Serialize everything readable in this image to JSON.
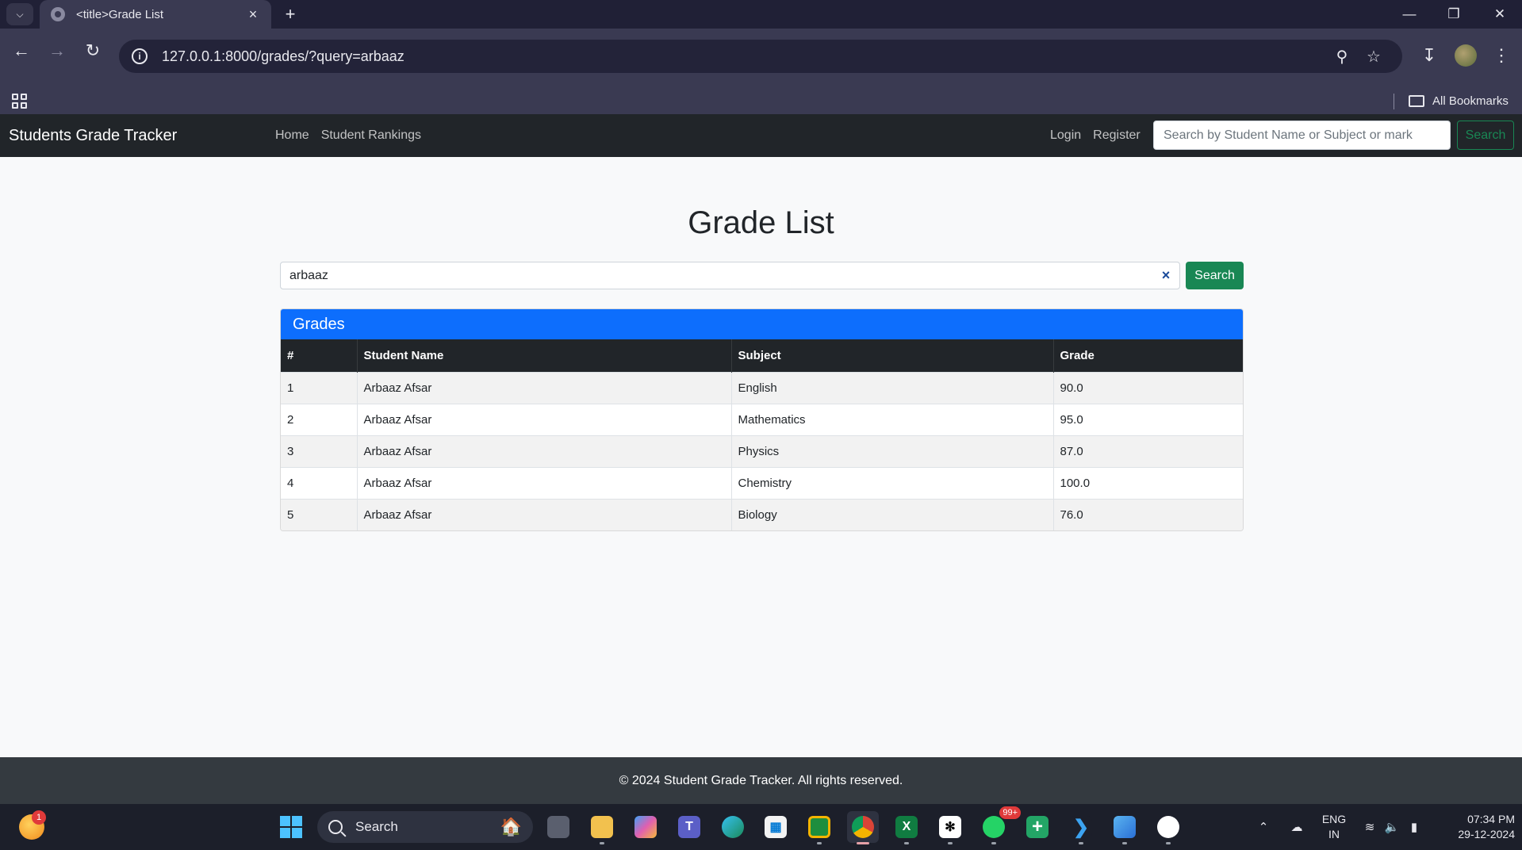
{
  "browser": {
    "tab_title": "<title>Grade List",
    "url": "127.0.0.1:8000/grades/?query=arbaaz",
    "bookmarks_label": "All Bookmarks"
  },
  "navbar": {
    "brand": "Students Grade Tracker",
    "links": [
      "Home",
      "Student Rankings"
    ],
    "login": "Login",
    "register": "Register",
    "search_placeholder": "Search by Student Name or Subject or mark",
    "search_button": "Search"
  },
  "main": {
    "title": "Grade List",
    "search_value": "arbaaz",
    "clear_symbol": "×",
    "search_button": "Search",
    "card_title": "Grades",
    "columns": [
      "#",
      "Student Name",
      "Subject",
      "Grade"
    ],
    "rows": [
      [
        "1",
        "Arbaaz Afsar",
        "English",
        "90.0"
      ],
      [
        "2",
        "Arbaaz Afsar",
        "Mathematics",
        "95.0"
      ],
      [
        "3",
        "Arbaaz Afsar",
        "Physics",
        "87.0"
      ],
      [
        "4",
        "Arbaaz Afsar",
        "Chemistry",
        "100.0"
      ],
      [
        "5",
        "Arbaaz Afsar",
        "Biology",
        "76.0"
      ]
    ]
  },
  "footer": {
    "text": "© 2024 Student Grade Tracker. All rights reserved."
  },
  "taskbar": {
    "weather_badge": "1",
    "search_label": "Search",
    "whatsapp_badge": "99+",
    "lang_top": "ENG",
    "lang_bottom": "IN",
    "time": "07:34 PM",
    "date": "29-12-2024"
  },
  "colors": {
    "navbar_bg": "#212529",
    "card_header": "#0d6efd",
    "success": "#198754",
    "footer_bg": "#343a40"
  }
}
